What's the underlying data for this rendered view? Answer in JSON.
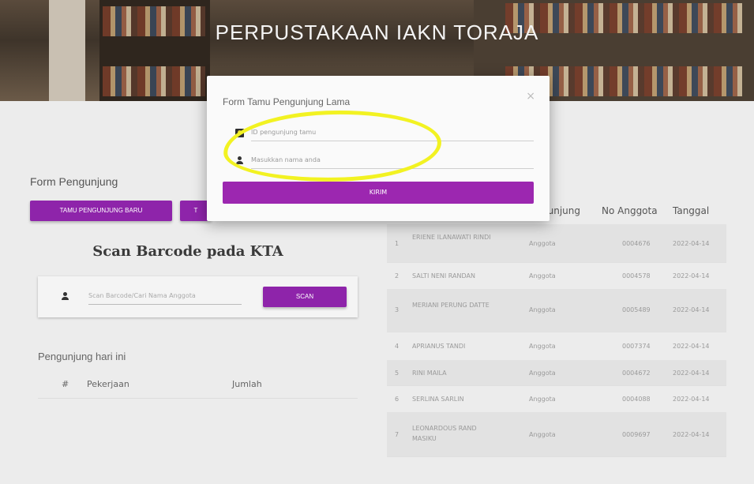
{
  "header": {
    "title": "PERPUSTAKAAN IAKN TORAJA"
  },
  "form": {
    "title": "Form Pengunjung",
    "btn_new": "TAMU PENGUNJUNG BARU",
    "btn_old": "T"
  },
  "scan": {
    "heading": "Scan Barcode pada KTA",
    "placeholder": "Scan Barcode/Cari Nama Anggota",
    "button": "SCAN"
  },
  "today": {
    "title": "Pengunjung hari ini",
    "col_num": "#",
    "col_job": "Pekerjaan",
    "col_count": "Jumlah"
  },
  "visitors": {
    "headers": [
      "gunjung",
      "No Anggota",
      "Tanggal"
    ],
    "rows": [
      {
        "num": "1",
        "name": "ERIENE ILANAWATI RINDI",
        "type": "Anggota",
        "id": "0004676",
        "date": "2022-04-14"
      },
      {
        "num": "2",
        "name": "SALTI NENI RANDAN",
        "type": "Anggota",
        "id": "0004578",
        "date": "2022-04-14"
      },
      {
        "num": "3",
        "name": "MERIANI PERUNG DATTE",
        "type": "Anggota",
        "id": "0005489",
        "date": "2022-04-14"
      },
      {
        "num": "4",
        "name": "APRIANUS TANDI",
        "type": "Anggota",
        "id": "0007374",
        "date": "2022-04-14"
      },
      {
        "num": "5",
        "name": "RINI MAILA",
        "type": "Anggota",
        "id": "0004672",
        "date": "2022-04-14"
      },
      {
        "num": "6",
        "name": "SERLINA SARLIN",
        "type": "Anggota",
        "id": "0004088",
        "date": "2022-04-14"
      },
      {
        "num": "7",
        "name": "LEONARDOUS RAND MASIKU",
        "type": "Anggota",
        "id": "0009697",
        "date": "2022-04-14"
      }
    ]
  },
  "modal": {
    "title": "Form Tamu Pengunjung Lama",
    "close": "×",
    "id_placeholder": "ID pengunjung tamu",
    "name_placeholder": "Masukkan nama anda",
    "send": "KIRIM"
  },
  "colors": {
    "primary": "#9c27b0",
    "highlight": "#f2f222"
  }
}
